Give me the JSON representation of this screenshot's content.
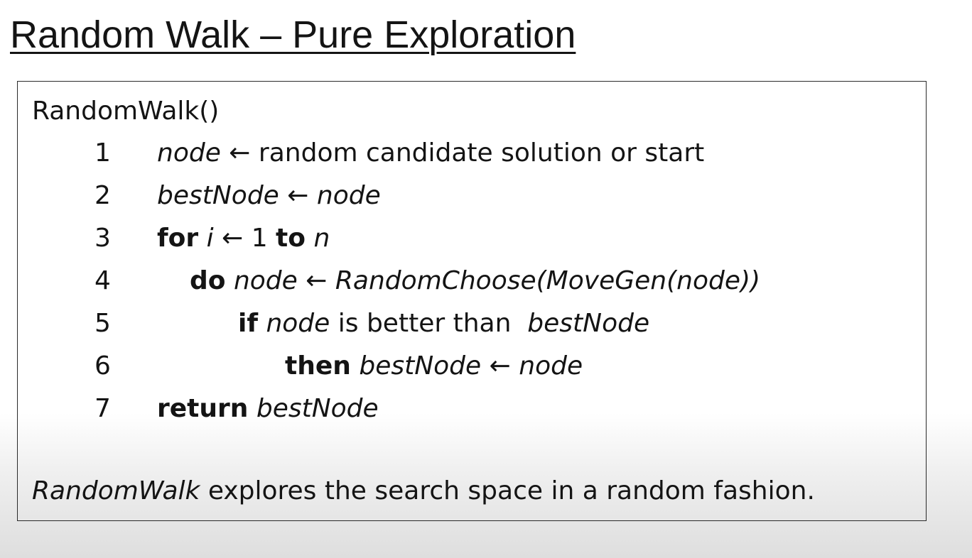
{
  "title": "Random Walk – Pure Exploration",
  "algorithm": {
    "name": "RandomWalk()",
    "arrow": "←",
    "lines": [
      {
        "num": "1",
        "var": "node",
        "text": " random candidate solution or start"
      },
      {
        "num": "2",
        "var": "bestNode",
        "value": "node"
      },
      {
        "num": "3",
        "kw_for": "for",
        "var": "i",
        "start": " 1 ",
        "kw_to": "to",
        "end": "n"
      },
      {
        "num": "4",
        "kw_do": "do",
        "var": "node",
        "value": "RandomChoose(MoveGen(node))"
      },
      {
        "num": "5",
        "kw_if": "if",
        "var": "node",
        "text": " is better than  ",
        "value": "bestNode"
      },
      {
        "num": "6",
        "kw_then": "then",
        "var": "bestNode",
        "value": "node"
      },
      {
        "num": "7",
        "kw_return": "return",
        "value": "bestNode"
      }
    ]
  },
  "note": {
    "name": "RandomWalk",
    "text": " explores the search space in a random fashion."
  }
}
